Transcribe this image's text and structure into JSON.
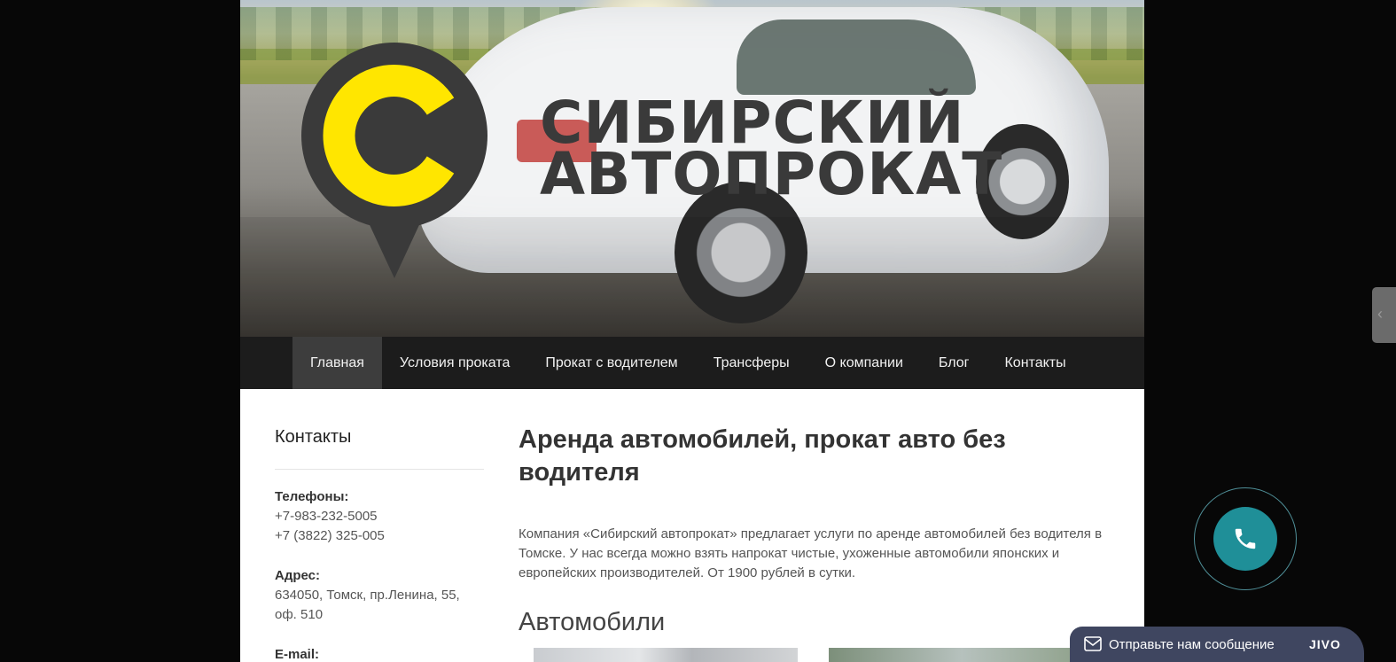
{
  "brand": {
    "logo_letter": "С",
    "name_line1": "СИБИРСКИЙ",
    "name_line2": "АВТОПРОКАТ",
    "accent": "#ffe600",
    "dark": "#3a3a3a"
  },
  "nav": {
    "items": [
      {
        "label": "Главная",
        "active": true
      },
      {
        "label": "Условия проката"
      },
      {
        "label": "Прокат с водителем"
      },
      {
        "label": "Трансферы"
      },
      {
        "label": "О компании"
      },
      {
        "label": "Блог"
      },
      {
        "label": "Контакты"
      }
    ]
  },
  "sidebar": {
    "title": "Контакты",
    "phones_label": "Телефоны:",
    "phone1": "+7-983-232-5005",
    "phone2": "+7 (3822) 325-005",
    "address_label": "Адрес:",
    "address": "634050, Томск, пр.Ленина, 55, оф. 510",
    "email_label": "E-mail:"
  },
  "main": {
    "heading": "Аренда автомобилей, прокат авто без водителя",
    "intro": "Компания «Сибирский автопрокат» предлагает услуги по аренде автомобилей без водителя в Томске. У нас всегда можно взять напрокат чистые, ухоженные автомобили японских и европейских производителей. От 1900 рублей в сутки.",
    "cars_heading": "Автомобили"
  },
  "widgets": {
    "side_tab_glyph": "‹",
    "call_color": "#1f8f98",
    "chat_message": "Отправьте нам сообщение",
    "chat_brand": "JIVO"
  }
}
